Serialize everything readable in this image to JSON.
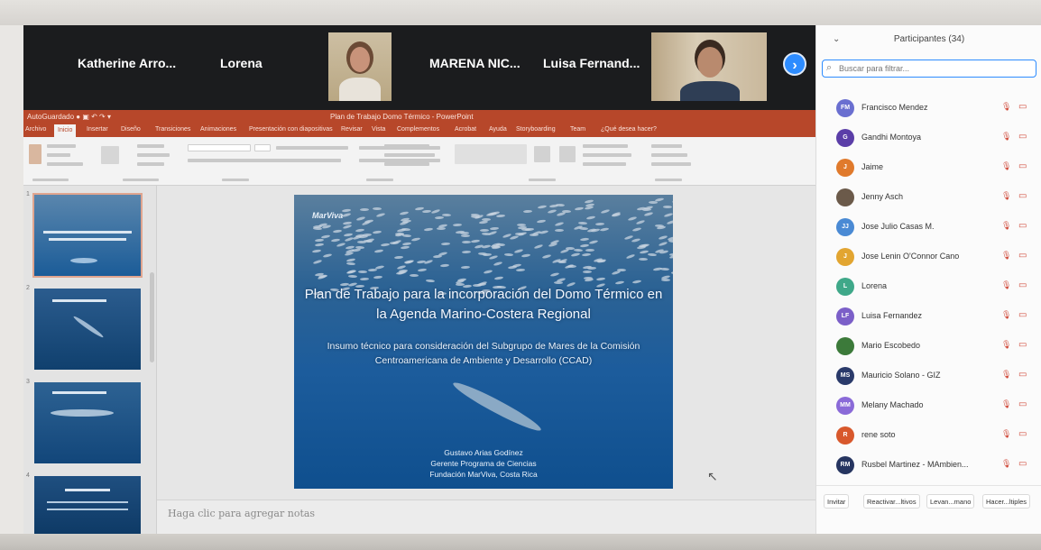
{
  "gallery": {
    "names": [
      "Katherine Arro...",
      "Lorena",
      "MARENA NIC...",
      "Luisa Fernand..."
    ],
    "next_icon": "chevron-right-icon"
  },
  "powerpoint": {
    "window_title": "Plan de Trabajo Domo Térmico - PowerPoint",
    "tabs": [
      "Archivo",
      "Inicio",
      "Insertar",
      "Diseño",
      "Transiciones",
      "Animaciones",
      "Presentación con diapositivas",
      "Revisar",
      "Vista",
      "Complementos",
      "Acrobat",
      "Ayuda",
      "Storyboarding",
      "Team",
      "¿Qué desea hacer?"
    ],
    "active_tab": "Inicio",
    "thumb_numbers": [
      "1",
      "2",
      "3",
      "4"
    ],
    "slide": {
      "logo": "MarViva",
      "title": "Plan de Trabajo para la incorporación del Domo Térmico en la Agenda Marino-Costera Regional",
      "subtitle": "Insumo técnico para consideración del Subgrupo de Mares de la Comisión Centroamericana de Ambiente y Desarrollo (CCAD)",
      "author_lines": [
        "Gustavo Arias Godínez",
        "Gerente Programa de Ciencias",
        "Fundación MarViva, Costa Rica"
      ]
    },
    "notes_placeholder": "Haga clic para agregar notas"
  },
  "participants": {
    "title": "Participantes (34)",
    "search_placeholder": "Buscar para filtrar...",
    "list": [
      {
        "name": "Francisco Mendez",
        "initials": "FM",
        "color": "#6a6fd0"
      },
      {
        "name": "Gandhi Montoya",
        "initials": "G",
        "color": "#5b3ea8"
      },
      {
        "name": "Jaime",
        "initials": "J",
        "color": "#e07a2c"
      },
      {
        "name": "Jenny Asch",
        "initials": "",
        "color": "#6b5a4a"
      },
      {
        "name": "Jose Julio Casas M.",
        "initials": "JJ",
        "color": "#4a8ad4"
      },
      {
        "name": "Jose Lenin O'Connor Cano",
        "initials": "J",
        "color": "#e2a531"
      },
      {
        "name": "Lorena",
        "initials": "L",
        "color": "#3fa889"
      },
      {
        "name": "Luisa Fernandez",
        "initials": "LF",
        "color": "#7b5fc8"
      },
      {
        "name": "Mario Escobedo",
        "initials": "",
        "color": "#3c7a3a"
      },
      {
        "name": "Mauricio Solano - GIZ",
        "initials": "MS",
        "color": "#2a3a6a"
      },
      {
        "name": "Melany Machado",
        "initials": "MM",
        "color": "#8a6ad8"
      },
      {
        "name": "rene soto",
        "initials": "R",
        "color": "#d8582c"
      },
      {
        "name": "Rusbel Martinez - MAmbien...",
        "initials": "RM",
        "color": "#263560"
      }
    ],
    "mic_icon": "mic-muted-icon",
    "cam_icon": "video-off-icon",
    "footer_buttons": [
      "Invitar",
      "Reactivar...ltivos",
      "Levan...mano",
      "Hacer...ltiples"
    ]
  }
}
